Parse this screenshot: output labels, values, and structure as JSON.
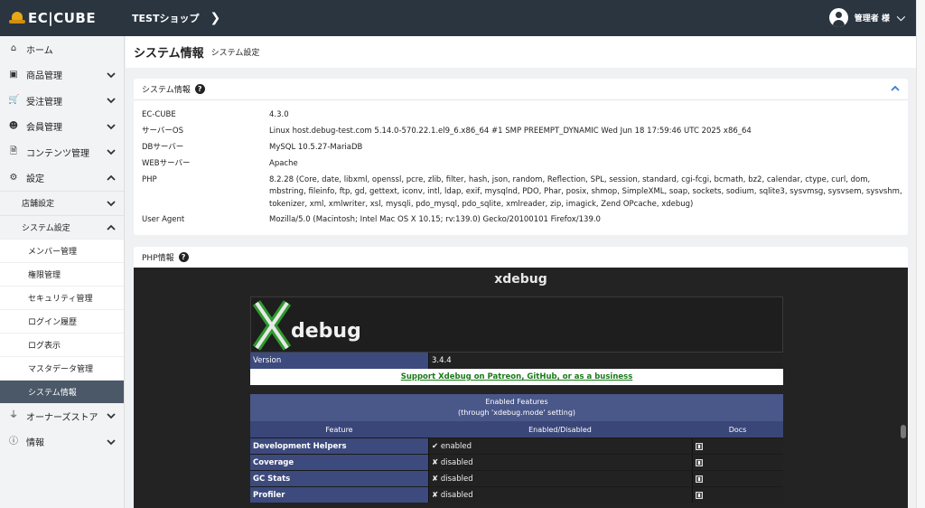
{
  "header": {
    "brand": "EC|CUBE",
    "shop_name": "TESTショップ",
    "user_label": "管理者 様"
  },
  "sidebar": {
    "items": [
      {
        "label": "ホーム",
        "icon": "home-icon"
      },
      {
        "label": "商品管理",
        "icon": "cube-icon"
      },
      {
        "label": "受注管理",
        "icon": "cart-icon"
      },
      {
        "label": "会員管理",
        "icon": "users-icon"
      },
      {
        "label": "コンテンツ管理",
        "icon": "file-icon"
      },
      {
        "label": "設定",
        "icon": "gear-icon"
      }
    ],
    "settings_children": {
      "shop": "店舗設定",
      "system": "システム設定"
    },
    "system_children": [
      "メンバー管理",
      "権限管理",
      "セキュリティ管理",
      "ログイン履歴",
      "ログ表示",
      "マスタデータ管理",
      "システム情報"
    ],
    "owners_store": "オーナーズストア",
    "info": "情報"
  },
  "page": {
    "title": "システム情報",
    "subtitle": "システム設定"
  },
  "system_info": {
    "card_title": "システム情報",
    "rows": [
      {
        "key": "EC-CUBE",
        "value": "4.3.0"
      },
      {
        "key": "サーバーOS",
        "value": "Linux host.debug-test.com 5.14.0-570.22.1.el9_6.x86_64 #1 SMP PREEMPT_DYNAMIC Wed Jun 18 17:59:46 UTC 2025 x86_64"
      },
      {
        "key": "DBサーバー",
        "value": "MySQL 10.5.27-MariaDB"
      },
      {
        "key": "WEBサーバー",
        "value": "Apache"
      },
      {
        "key": "PHP",
        "value": "8.2.28 (Core, date, libxml, openssl, pcre, zlib, filter, hash, json, random, Reflection, SPL, session, standard, cgi-fcgi, bcmath, bz2, calendar, ctype, curl, dom, mbstring, fileinfo, ftp, gd, gettext, iconv, intl, ldap, exif, mysqlnd, PDO, Phar, posix, shmop, SimpleXML, soap, sockets, sodium, sqlite3, sysvmsg, sysvsem, sysvshm, tokenizer, xml, xmlwriter, xsl, mysqli, pdo_mysql, pdo_sqlite, xmlreader, zip, imagick, Zend OPcache, xdebug)"
      },
      {
        "key": "User Agent",
        "value": "Mozilla/5.0 (Macintosh; Intel Mac OS X 10.15; rv:139.0) Gecko/20100101 Firefox/139.0"
      }
    ]
  },
  "php_info": {
    "card_title": "PHP情報",
    "section_title": "xdebug",
    "logo_text": "debug",
    "version_label": "Version",
    "version_value": "3.4.4",
    "support_link": "Support Xdebug on Patreon, GitHub, or as a business",
    "features_title_1": "Enabled Features",
    "features_title_2": "(through 'xdebug.mode' setting)",
    "col_feature": "Feature",
    "col_enabled": "Enabled/Disabled",
    "col_docs": "Docs",
    "features": [
      {
        "name": "Development Helpers",
        "status": "✔ enabled"
      },
      {
        "name": "Coverage",
        "status": "✘ disabled"
      },
      {
        "name": "GC Stats",
        "status": "✘ disabled"
      },
      {
        "name": "Profiler",
        "status": "✘ disabled"
      }
    ]
  },
  "colors": {
    "header_bg": "#2a3540",
    "active_nav": "#4a5868",
    "xdebug_blue": "#3d4a7d",
    "link_green": "#1b7a1b"
  }
}
